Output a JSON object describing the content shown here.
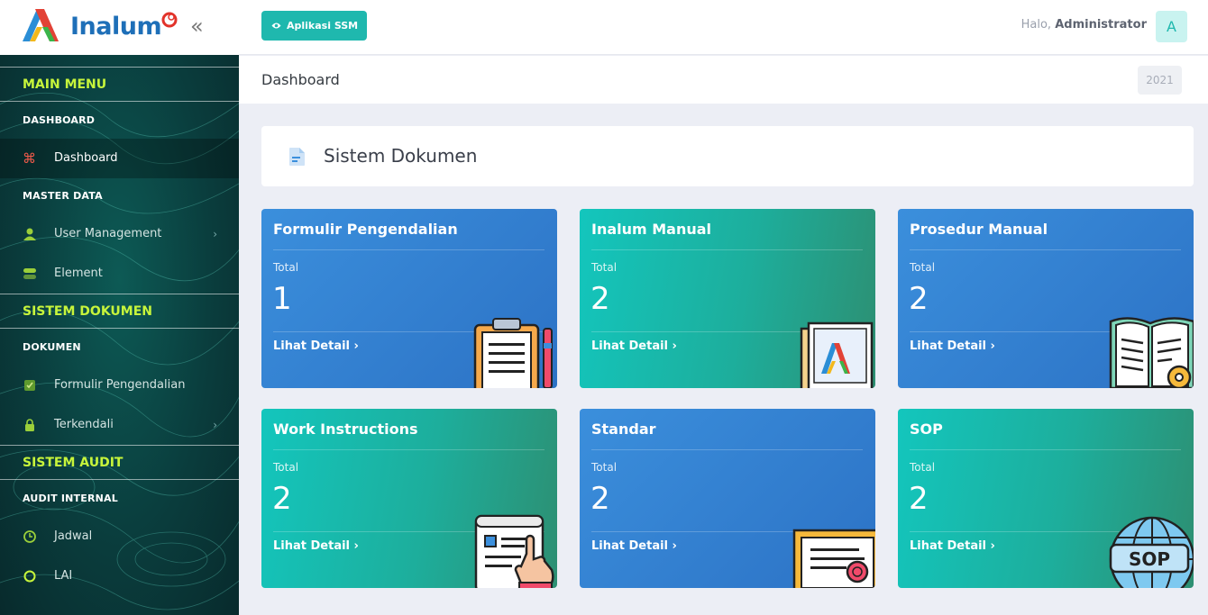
{
  "brand": {
    "name": "Inalum"
  },
  "topbar": {
    "app_button": "Aplikasi SSM",
    "greeting_prefix": "Halo,",
    "greeting_user": "Administrator",
    "avatar_initial": "A"
  },
  "sidebar": {
    "sec_main": "MAIN MENU",
    "grp_dashboard": "DASHBOARD",
    "item_dashboard": "Dashboard",
    "grp_master": "MASTER DATA",
    "item_user_mgmt": "User Management",
    "item_element": "Element",
    "sec_dokumen": "SISTEM DOKUMEN",
    "grp_dokumen": "DOKUMEN",
    "item_formulir": "Formulir Pengendalian",
    "item_terkendali": "Terkendali",
    "sec_audit": "SISTEM AUDIT",
    "grp_audit": "AUDIT INTERNAL",
    "item_jadwal": "Jadwal",
    "item_lai": "LAI"
  },
  "page": {
    "title": "Dashboard",
    "year": "2021"
  },
  "section": {
    "title": "Sistem Dokumen"
  },
  "cards": [
    {
      "title": "Formulir Pengendalian",
      "total_label": "Total",
      "value": "1",
      "link": "Lihat Detail",
      "icon": "clipboard-icon"
    },
    {
      "title": "Inalum Manual",
      "total_label": "Total",
      "value": "2",
      "link": "Lihat Detail",
      "icon": "manual-book-icon"
    },
    {
      "title": "Prosedur Manual",
      "total_label": "Total",
      "value": "2",
      "link": "Lihat Detail",
      "icon": "open-book-gear-icon"
    },
    {
      "title": "Work Instructions",
      "total_label": "Total",
      "value": "2",
      "link": "Lihat Detail",
      "icon": "document-hand-icon"
    },
    {
      "title": "Standar",
      "total_label": "Total",
      "value": "2",
      "link": "Lihat Detail",
      "icon": "certificate-icon"
    },
    {
      "title": "SOP",
      "total_label": "Total",
      "value": "2",
      "link": "Lihat Detail",
      "icon": "sop-globe-icon"
    }
  ],
  "colors": {
    "accent": "#1fb8ae",
    "sidebar_section": "#c7f53b",
    "card_blue": "#2c72c5",
    "card_teal": "#13c6bd"
  }
}
